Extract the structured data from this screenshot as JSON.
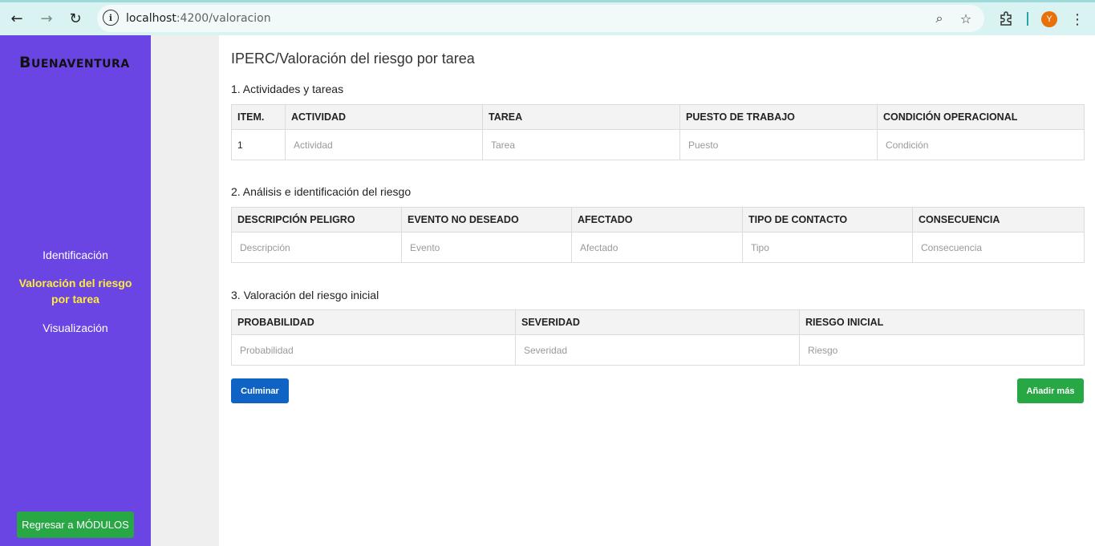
{
  "browser": {
    "url_host": "localhost",
    "url_path": ":4200/valoracion",
    "avatar_letter": "Y"
  },
  "sidebar": {
    "logo_initial": "B",
    "logo_rest": "UENAVENTURA",
    "items": [
      {
        "label": "Identificación",
        "active": false
      },
      {
        "label": "Valoración del riesgo por tarea",
        "active": true
      },
      {
        "label": "Visualización",
        "active": false
      }
    ],
    "back_button": "Regresar a MÓDULOS"
  },
  "main": {
    "title": "IPERC/Valoración del riesgo por tarea",
    "section1": {
      "title": "1. Actividades y tareas",
      "headers": [
        "ITEM.",
        "ACTIVIDAD",
        "TAREA",
        "PUESTO DE TRABAJO",
        "CONDICIÓN OPERACIONAL"
      ],
      "row": {
        "item": "1",
        "placeholders": [
          "Actividad",
          "Tarea",
          "Puesto",
          "Condición"
        ]
      }
    },
    "section2": {
      "title": "2. Análisis e identificación del riesgo",
      "headers": [
        "DESCRIPCIÓN PELIGRO",
        "EVENTO NO DESEADO",
        "AFECTADO",
        "TIPO DE CONTACTO",
        "CONSECUENCIA"
      ],
      "placeholders": [
        "Descripción",
        "Evento",
        "Afectado",
        "Tipo",
        "Consecuencia"
      ]
    },
    "section3": {
      "title": "3. Valoración del riesgo inicial",
      "headers": [
        "PROBABILIDAD",
        "SEVERIDAD",
        "RIESGO INICIAL"
      ],
      "placeholders": [
        "Probabilidad",
        "Severidad",
        "Riesgo"
      ]
    },
    "culminar_button": "Culminar",
    "anadir_button": "Añadir más"
  },
  "colors": {
    "sidebar_bg": "#6a45e3",
    "active_item": "#ffeb3b",
    "primary_button": "#0e63c4",
    "success_button": "#28a745"
  }
}
